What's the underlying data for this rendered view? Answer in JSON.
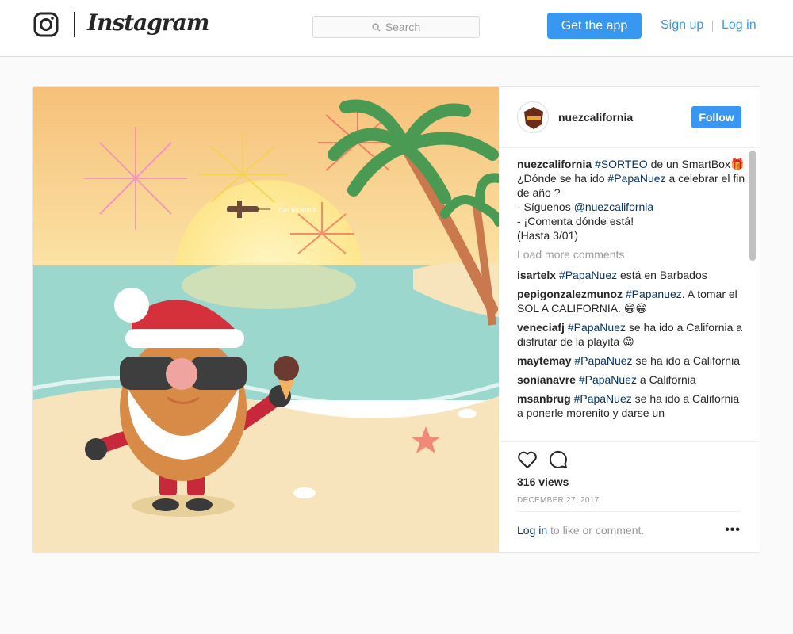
{
  "header": {
    "logo_text": "Instagram",
    "search_placeholder": "Search",
    "get_app_label": "Get the app",
    "signup_label": "Sign up",
    "login_label": "Log in",
    "accent_color": "#3897f0"
  },
  "image_overlay": {
    "banner_text": "CALIFORNIA"
  },
  "post": {
    "username": "nuezcalifornia",
    "follow_label": "Follow",
    "caption": {
      "username": "nuezcalifornia",
      "hashtag": "#SORTEO",
      "text1": " de un SmartBox🎁",
      "line2_pre": "¿Dónde se ha ido ",
      "line2_tag": "#PapaNuez",
      "line2_post": " a celebrar el fin de año ?",
      "line3_pre": "- Síguenos ",
      "line3_mention": "@nuezcalifornia",
      "line4": "- ¡Comenta dónde está!",
      "line5": "(Hasta 3/01)"
    },
    "load_more": "Load more comments",
    "comments": [
      {
        "user": "isartelx",
        "tag": "#PapaNuez",
        "text": " está en Barbados"
      },
      {
        "user": "pepigonzalezmunoz",
        "tag": "#Papanuez",
        "text": ". A tomar el SOL A CALIFORNIA. 😁😁"
      },
      {
        "user": "veneciafj",
        "tag": "#PapaNuez",
        "text": " se ha ido a California a disfrutar de la playita 😁"
      },
      {
        "user": "maytemay",
        "tag": "#PapaNuez",
        "text": " se ha ido a California"
      },
      {
        "user": "sonianavre",
        "tag": "#PapaNuez",
        "text": " a California"
      },
      {
        "user": "msanbrug",
        "tag": "#PapaNuez",
        "text": " se ha ido a California a ponerle morenito y darse un"
      }
    ],
    "views": "316 views",
    "date": "DECEMBER 27, 2017",
    "login_link": "Log in",
    "login_suffix": " to like or comment.",
    "more_options": "•••"
  }
}
